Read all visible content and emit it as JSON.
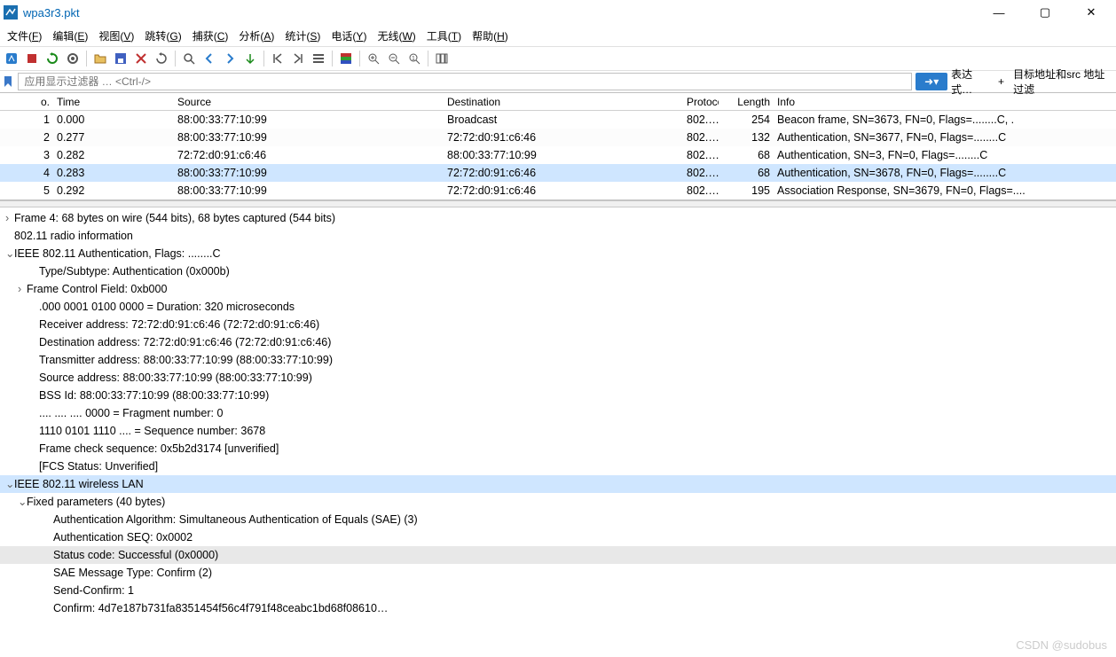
{
  "window": {
    "title": "wpa3r3.pkt"
  },
  "menu": {
    "items": [
      {
        "label": "文件",
        "key": "F"
      },
      {
        "label": "编辑",
        "key": "E"
      },
      {
        "label": "视图",
        "key": "V"
      },
      {
        "label": "跳转",
        "key": "G"
      },
      {
        "label": "捕获",
        "key": "C"
      },
      {
        "label": "分析",
        "key": "A"
      },
      {
        "label": "统计",
        "key": "S"
      },
      {
        "label": "电话",
        "key": "Y"
      },
      {
        "label": "无线",
        "key": "W"
      },
      {
        "label": "工具",
        "key": "T"
      },
      {
        "label": "帮助",
        "key": "H"
      }
    ]
  },
  "filter": {
    "placeholder": "应用显示过滤器 … <Ctrl-/>",
    "expr_label": "表达式…",
    "tail_label": "目标地址和src 地址过滤"
  },
  "columns": {
    "no": "o.",
    "time": "Time",
    "source": "Source",
    "destination": "Destination",
    "protocol": "Protoco",
    "length": "Length",
    "info": "Info"
  },
  "packets": [
    {
      "no": "1",
      "time": "0.000",
      "src": "88:00:33:77:10:99",
      "dst": "Broadcast",
      "proto": "802.…",
      "len": "254",
      "info": "Beacon frame, SN=3673, FN=0, Flags=........C, ."
    },
    {
      "no": "2",
      "time": "0.277",
      "src": "88:00:33:77:10:99",
      "dst": "72:72:d0:91:c6:46",
      "proto": "802.…",
      "len": "132",
      "info": "Authentication, SN=3677, FN=0, Flags=........C"
    },
    {
      "no": "3",
      "time": "0.282",
      "src": "72:72:d0:91:c6:46",
      "dst": "88:00:33:77:10:99",
      "proto": "802.…",
      "len": "68",
      "info": "Authentication, SN=3, FN=0, Flags=........C"
    },
    {
      "no": "4",
      "time": "0.283",
      "src": "88:00:33:77:10:99",
      "dst": "72:72:d0:91:c6:46",
      "proto": "802.…",
      "len": "68",
      "info": "Authentication, SN=3678, FN=0, Flags=........C"
    },
    {
      "no": "5",
      "time": "0.292",
      "src": "88:00:33:77:10:99",
      "dst": "72:72:d0:91:c6:46",
      "proto": "802.…",
      "len": "195",
      "info": "Association Response, SN=3679, FN=0, Flags=...."
    }
  ],
  "selected_packet_index": 3,
  "details": {
    "l0": "Frame 4: 68 bytes on wire (544 bits), 68 bytes captured (544 bits)",
    "l1": "802.11 radio information",
    "l2": "IEEE 802.11 Authentication, Flags: ........C",
    "l3": "Type/Subtype: Authentication (0x000b)",
    "l4": "Frame Control Field: 0xb000",
    "l5": ".000 0001 0100 0000 = Duration: 320 microseconds",
    "l6": "Receiver address: 72:72:d0:91:c6:46 (72:72:d0:91:c6:46)",
    "l7": "Destination address: 72:72:d0:91:c6:46 (72:72:d0:91:c6:46)",
    "l8": "Transmitter address: 88:00:33:77:10:99 (88:00:33:77:10:99)",
    "l9": "Source address: 88:00:33:77:10:99 (88:00:33:77:10:99)",
    "l10": "BSS Id: 88:00:33:77:10:99 (88:00:33:77:10:99)",
    "l11": ".... .... .... 0000 = Fragment number: 0",
    "l12": "1110 0101 1110 .... = Sequence number: 3678",
    "l13": "Frame check sequence: 0x5b2d3174 [unverified]",
    "l14": "[FCS Status: Unverified]",
    "l15": "IEEE 802.11 wireless LAN",
    "l16": "Fixed parameters (40 bytes)",
    "l17": "Authentication Algorithm: Simultaneous Authentication of Equals (SAE) (3)",
    "l18": "Authentication SEQ: 0x0002",
    "l19": "Status code: Successful (0x0000)",
    "l20": "SAE Message Type: Confirm (2)",
    "l21": "Send-Confirm: 1",
    "l22": "Confirm: 4d7e187b731fa8351454f56c4f791f48ceabc1bd68f08610…"
  },
  "watermark": "CSDN @sudobus"
}
